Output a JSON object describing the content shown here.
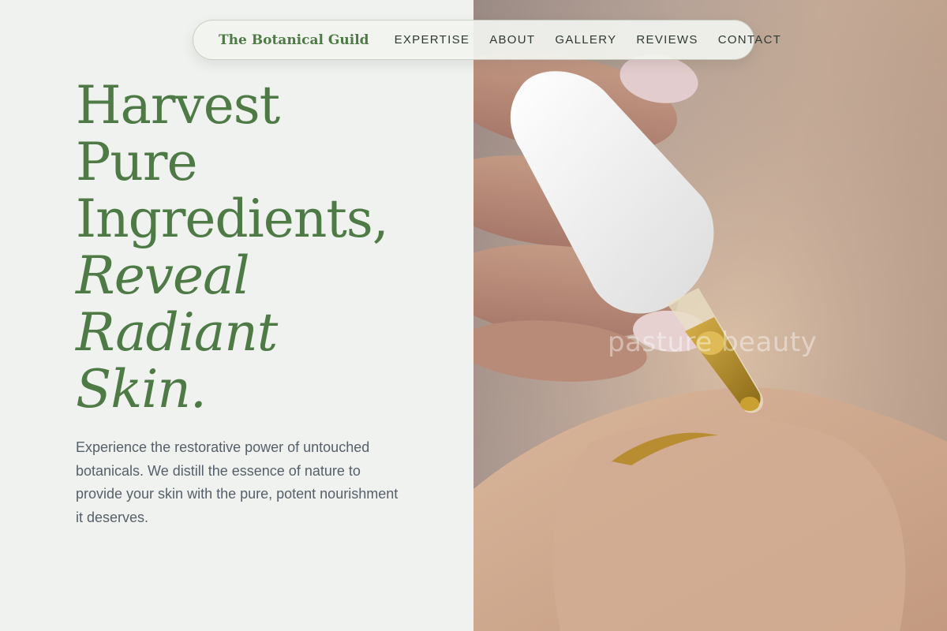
{
  "nav": {
    "brand": "The Botanical Guild",
    "links": [
      {
        "label": "EXPERTISE"
      },
      {
        "label": "ABOUT"
      },
      {
        "label": "GALLERY"
      },
      {
        "label": "REVIEWS"
      },
      {
        "label": "CONTACT"
      }
    ]
  },
  "hero": {
    "headline_lines": [
      "Harvest",
      "Pure",
      "Ingredients,"
    ],
    "headline_italic_lines": [
      "Reveal",
      "Radiant",
      "Skin."
    ],
    "intro": "Experience the restorative power of untouched botanicals. We distill the essence of nature to provide your skin with the pure, potent nourishment it deserves.",
    "image_watermark": "pasture beauty"
  },
  "colors": {
    "accent_green": "#4e7a45",
    "background": "#f0f2ef",
    "body_text": "#56606a",
    "nav_text": "#2f3a33"
  }
}
